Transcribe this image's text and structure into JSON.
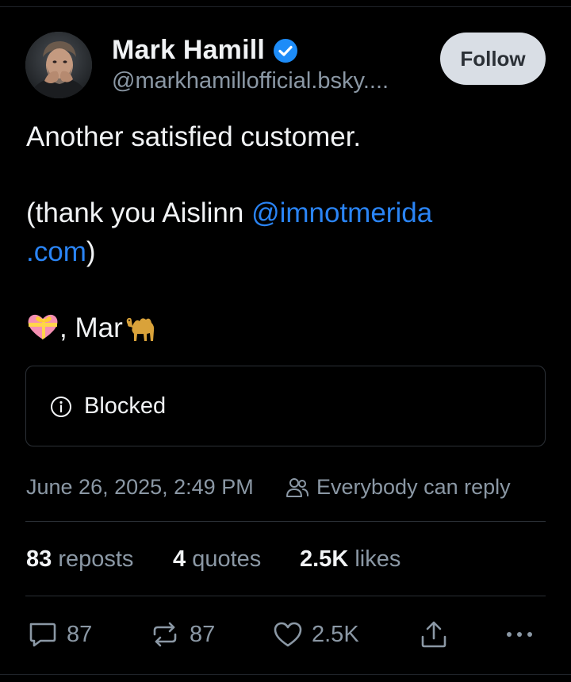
{
  "author": {
    "display_name": "Mark Hamill",
    "handle": "@markhamillofficial.bsky....",
    "verified": true,
    "avatar": "avatar-photo"
  },
  "follow_button": {
    "label": "Follow"
  },
  "post": {
    "line1": "Another satisfied customer.",
    "line2_prefix": "(thank you Aislinn ",
    "mention_part1": "@imnotmerida",
    "mention_part2": ".com",
    "line3_suffix": ")",
    "signoff_text": ", Mar",
    "signoff_emojis": [
      "heart-with-ribbon-emoji",
      "camel-emoji"
    ]
  },
  "embed": {
    "icon": "info-icon",
    "label": "Blocked"
  },
  "meta": {
    "timestamp": "June 26, 2025, 2:49 PM",
    "reply_icon": "people-icon",
    "reply_setting": "Everybody can reply"
  },
  "stats": {
    "reposts_count": "83",
    "reposts_label": "reposts",
    "quotes_count": "4",
    "quotes_label": "quotes",
    "likes_count": "2.5K",
    "likes_label": "likes"
  },
  "actions": {
    "reply_count": "87",
    "repost_count": "87",
    "like_count": "2.5K",
    "icons": [
      "reply-icon",
      "repost-icon",
      "like-icon",
      "share-icon",
      "more-icon"
    ]
  },
  "colors": {
    "background": "#000000",
    "text": "#f1f3f5",
    "muted": "#8b98a5",
    "link": "#2a84f5",
    "verified": "#1d8cf8",
    "follow_bg": "#d9dee5"
  }
}
